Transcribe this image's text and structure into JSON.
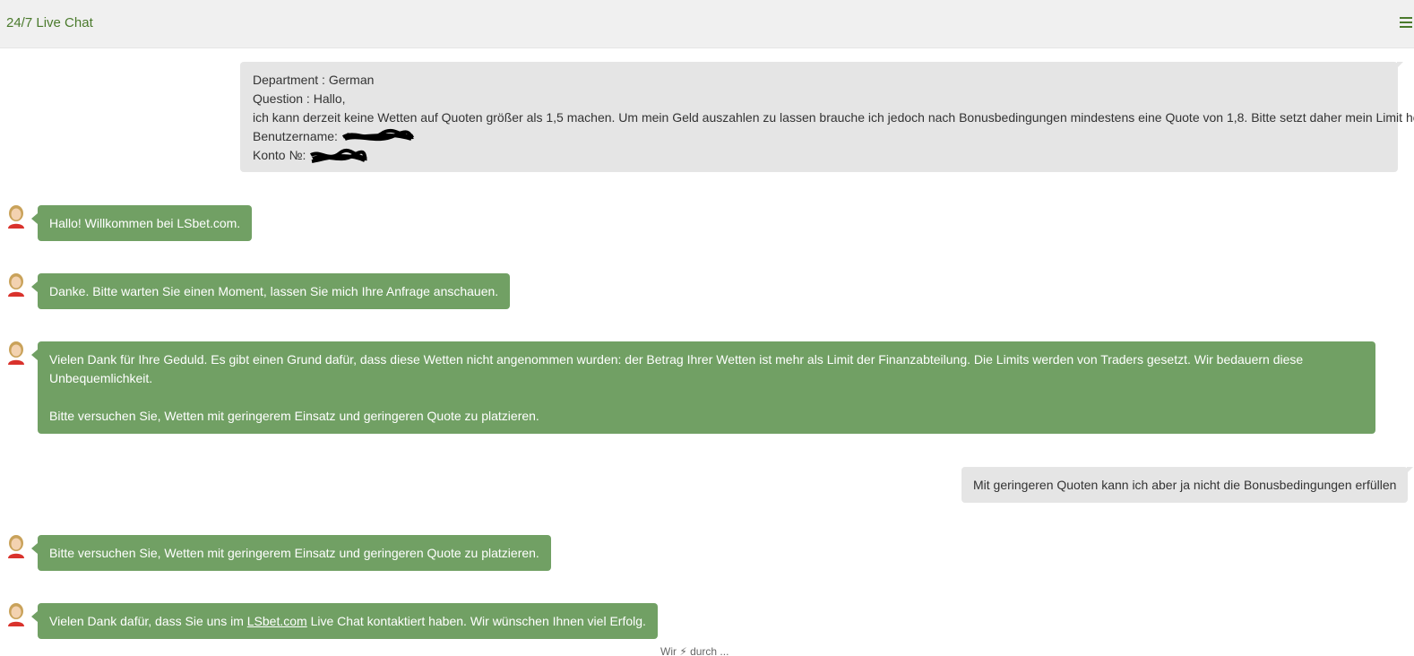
{
  "header": {
    "title": "24/7 Live Chat",
    "menu_icon": "hamburger-menu-icon",
    "accent_color": "#4a7a2c"
  },
  "colors": {
    "agent_bubble": "#71a064",
    "user_bubble": "#e5e5e5",
    "header_bg": "#f0f0f0"
  },
  "first_message": {
    "department_label": "Department : German",
    "question_label": "Question : Hallo,",
    "body": "ich kann derzeit keine Wetten auf Quoten größer als 1,5 machen. Um mein Geld auszahlen zu lassen brauche ich jedoch nach Bonusbedingungen mindestens eine Quote von 1,8. Bitte setzt daher mein Limit hoch",
    "username_label": "Benutzername:",
    "account_label": "Konto №:"
  },
  "messages": [
    {
      "sender": "agent",
      "text": "Hallo! Willkommen bei LSbet.com."
    },
    {
      "sender": "agent",
      "text": "Danke. Bitte warten Sie einen Moment, lassen Sie mich Ihre Anfrage anschauen."
    },
    {
      "sender": "agent",
      "text": "Vielen Dank für Ihre Geduld. Es gibt einen Grund dafür, dass diese Wetten nicht angenommen wurden: der Betrag Ihrer Wetten ist mehr als Limit der Finanzabteilung. Die Limits werden von Traders gesetzt. Wir bedauern diese Unbequemlichkeit.",
      "text2": "Bitte versuchen Sie, Wetten mit geringerem Einsatz und geringeren Quote zu platzieren."
    },
    {
      "sender": "user",
      "text": "Mit geringeren Quoten kann ich aber ja nicht die Bonusbedingungen erfüllen"
    },
    {
      "sender": "agent",
      "text": "Bitte versuchen Sie, Wetten mit geringerem Einsatz und geringeren Quote zu platzieren."
    },
    {
      "sender": "agent",
      "text_before": "Vielen Dank dafür, dass Sie uns im",
      "link": "LSbet.com",
      "text_after": " Live Chat kontaktiert haben. Wir wünschen Ihnen viel Erfolg."
    }
  ],
  "footer_note": "Wir ⚡ durch ..."
}
